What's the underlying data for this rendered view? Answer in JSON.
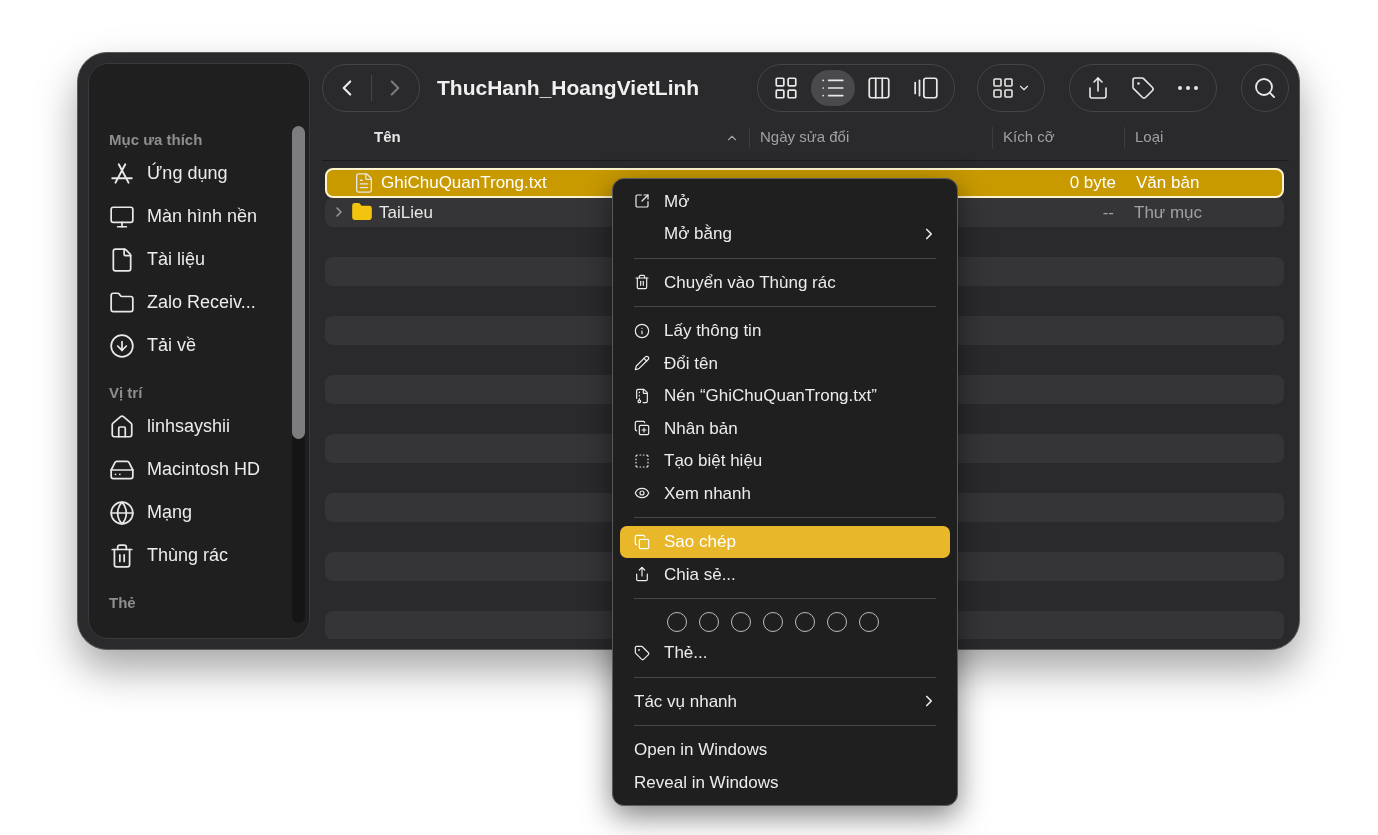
{
  "window": {
    "title": "ThucHanh_HoangVietLinh"
  },
  "sidebar": {
    "sections": [
      {
        "title": "Mục ưa thích",
        "items": [
          {
            "label": "Ứng dụng",
            "selected": false
          },
          {
            "label": "Màn hình nền",
            "selected": false
          },
          {
            "label": "Tài liệu",
            "selected": false
          },
          {
            "label": "Zalo Receiv...",
            "selected": false
          },
          {
            "label": "Tải về",
            "selected": false
          }
        ]
      },
      {
        "title": "Vị trí",
        "items": [
          {
            "label": "linhsayshii",
            "selected": false
          },
          {
            "label": "Macintosh HD",
            "selected": false
          },
          {
            "label": "Mạng",
            "selected": false
          },
          {
            "label": "Thùng rác",
            "selected": false
          }
        ]
      },
      {
        "title": "Thẻ"
      }
    ]
  },
  "toolbar": {
    "views": [
      {
        "kind": "icons",
        "selected": false
      },
      {
        "kind": "list",
        "selected": true
      },
      {
        "kind": "columns",
        "selected": false
      },
      {
        "kind": "gallery",
        "selected": false
      }
    ]
  },
  "table": {
    "columns": [
      {
        "label": "Tên",
        "sorted": true
      },
      {
        "label": "Ngày sửa đổi",
        "sorted": false
      },
      {
        "label": "Kích cỡ",
        "sorted": false
      },
      {
        "label": "Loại",
        "sorted": false
      }
    ],
    "rows": [
      {
        "kind": "file",
        "name": "GhiChuQuanTrong.txt",
        "size": "0 byte",
        "type": "Văn bản",
        "selected": true
      },
      {
        "kind": "folder",
        "name": "TaiLieu",
        "size": "--",
        "type": "Thư mục",
        "selected": false
      }
    ]
  },
  "context_menu": {
    "items": [
      {
        "kind": "command",
        "label": "Mở",
        "submenu": false,
        "selected": false
      },
      {
        "kind": "command",
        "label": "Mở bằng",
        "submenu": true,
        "selected": false
      },
      {
        "kind": "separator"
      },
      {
        "kind": "command",
        "label": "Chuyển vào Thùng rác",
        "submenu": false,
        "selected": false
      },
      {
        "kind": "separator"
      },
      {
        "kind": "command",
        "label": "Lấy thông tin",
        "submenu": false,
        "selected": false
      },
      {
        "kind": "command",
        "label": "Đổi tên",
        "submenu": false,
        "selected": false
      },
      {
        "kind": "command",
        "label": "Nén “GhiChuQuanTrong.txt”",
        "submenu": false,
        "selected": false
      },
      {
        "kind": "command",
        "label": "Nhân bản",
        "submenu": false,
        "selected": false
      },
      {
        "kind": "command",
        "label": "Tạo biệt hiệu",
        "submenu": false,
        "selected": false
      },
      {
        "kind": "command",
        "label": "Xem nhanh",
        "submenu": false,
        "selected": false
      },
      {
        "kind": "separator"
      },
      {
        "kind": "command",
        "label": "Sao chép",
        "submenu": false,
        "selected": true
      },
      {
        "kind": "command",
        "label": "Chia sẻ...",
        "submenu": false,
        "selected": false
      },
      {
        "kind": "separator"
      },
      {
        "kind": "tags"
      },
      {
        "kind": "command",
        "label": "Thẻ...",
        "submenu": false,
        "selected": false
      },
      {
        "kind": "separator"
      },
      {
        "kind": "action",
        "label": "Tác vụ nhanh",
        "submenu": true,
        "selected": false
      },
      {
        "kind": "separator"
      },
      {
        "kind": "action",
        "label": "Open in Windows",
        "submenu": false,
        "selected": false
      },
      {
        "kind": "action",
        "label": "Reveal in Windows",
        "submenu": false,
        "selected": false
      }
    ]
  }
}
